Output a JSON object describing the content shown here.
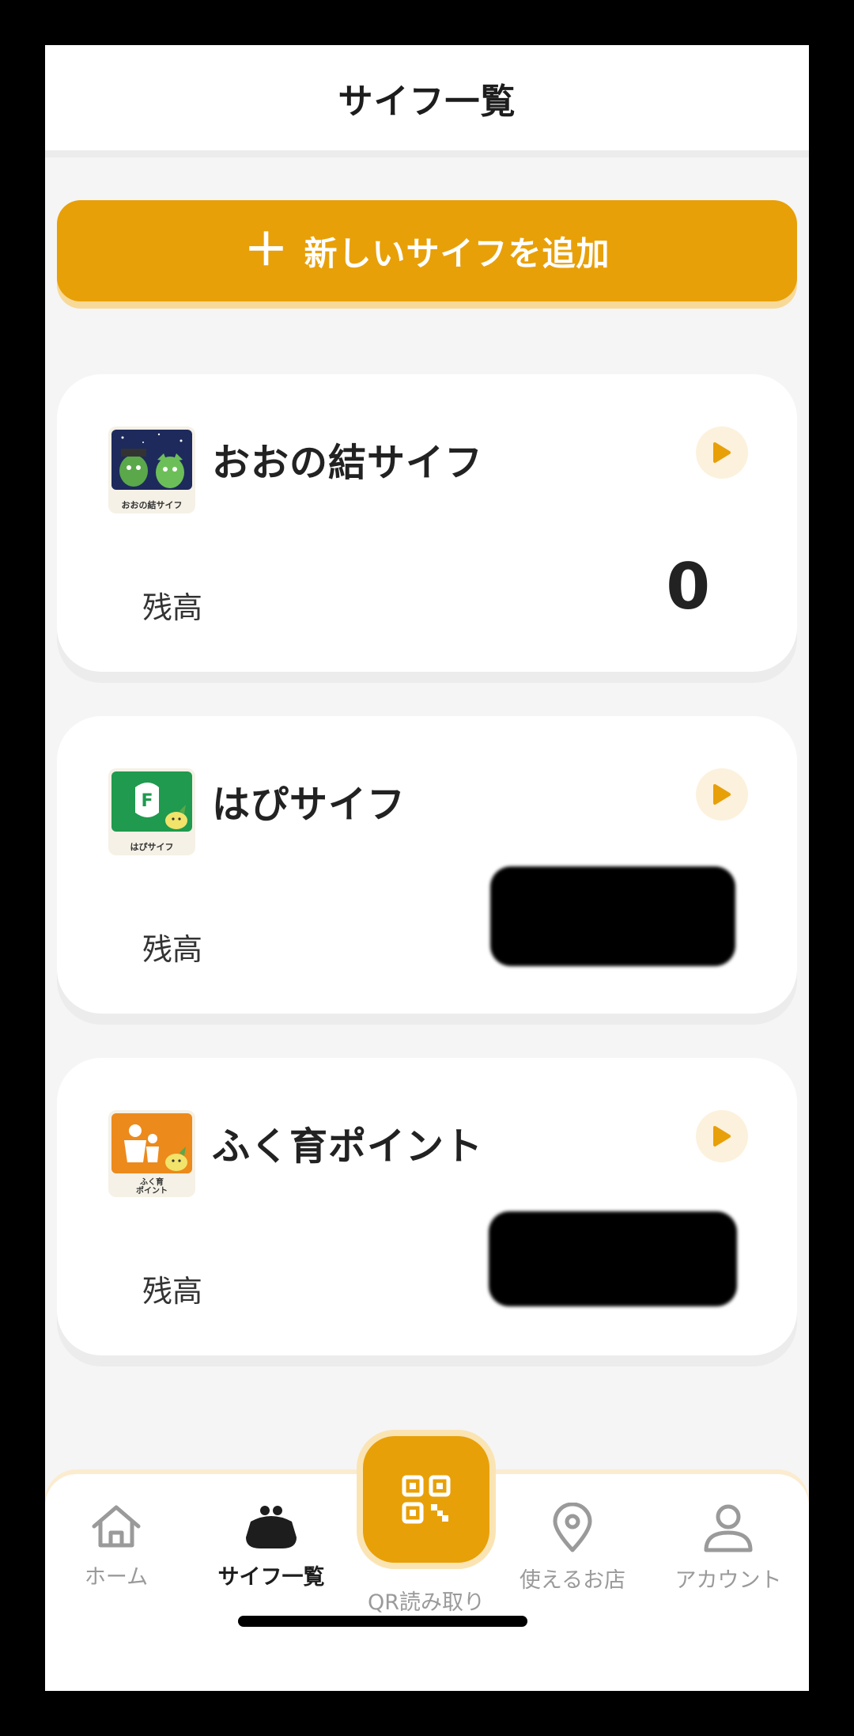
{
  "header": {
    "title": "サイフ一覧"
  },
  "add_button": {
    "icon": "plus-icon",
    "label": "新しいサイフを追加"
  },
  "wallets": [
    {
      "name": "おおの結サイフ",
      "logo_caption": "おおの結サイフ",
      "balance_label": "残高",
      "balance_value": "0",
      "redacted": false
    },
    {
      "name": "はぴサイフ",
      "logo_caption": "はぴサイフ",
      "balance_label": "残高",
      "balance_value": "",
      "redacted": true
    },
    {
      "name": "ふく育ポイント",
      "logo_caption_line1": "ふく育",
      "logo_caption_line2": "ポイント",
      "balance_label": "残高",
      "balance_value": "",
      "redacted": true
    }
  ],
  "bottom_nav": {
    "home": "ホーム",
    "wallets": "サイフ一覧",
    "qr": "QR読み取り",
    "stores": "使えるお店",
    "account": "アカウント"
  },
  "colors": {
    "accent": "#e8a008",
    "accent_light": "#fcf1dc",
    "background": "#f5f5f5"
  }
}
